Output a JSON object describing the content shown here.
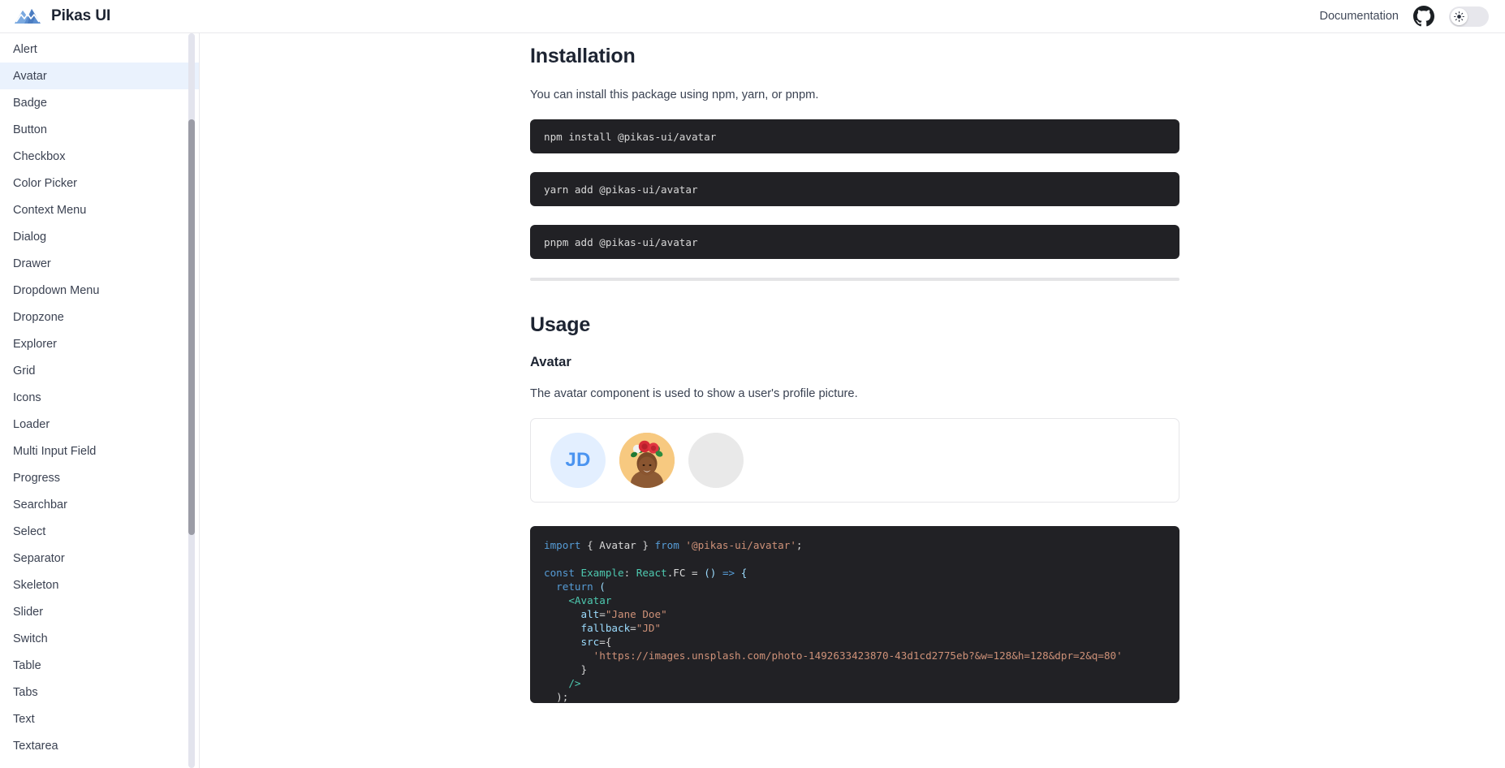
{
  "header": {
    "brand_title": "Pikas UI",
    "logo_icon": "pikas-mountain-logo",
    "documentation_label": "Documentation",
    "github_icon": "github-icon",
    "theme_toggle_icon": "sun-icon",
    "theme_toggle_state": "light"
  },
  "sidebar": {
    "items": [
      {
        "label": "Alert",
        "active": false
      },
      {
        "label": "Avatar",
        "active": true
      },
      {
        "label": "Badge",
        "active": false
      },
      {
        "label": "Button",
        "active": false
      },
      {
        "label": "Checkbox",
        "active": false
      },
      {
        "label": "Color Picker",
        "active": false
      },
      {
        "label": "Context Menu",
        "active": false
      },
      {
        "label": "Dialog",
        "active": false
      },
      {
        "label": "Drawer",
        "active": false
      },
      {
        "label": "Dropdown Menu",
        "active": false
      },
      {
        "label": "Dropzone",
        "active": false
      },
      {
        "label": "Explorer",
        "active": false
      },
      {
        "label": "Grid",
        "active": false
      },
      {
        "label": "Icons",
        "active": false
      },
      {
        "label": "Loader",
        "active": false
      },
      {
        "label": "Multi Input Field",
        "active": false
      },
      {
        "label": "Progress",
        "active": false
      },
      {
        "label": "Searchbar",
        "active": false
      },
      {
        "label": "Select",
        "active": false
      },
      {
        "label": "Separator",
        "active": false
      },
      {
        "label": "Skeleton",
        "active": false
      },
      {
        "label": "Slider",
        "active": false
      },
      {
        "label": "Switch",
        "active": false
      },
      {
        "label": "Table",
        "active": false
      },
      {
        "label": "Tabs",
        "active": false
      },
      {
        "label": "Text",
        "active": false
      },
      {
        "label": "Textarea",
        "active": false
      }
    ]
  },
  "main": {
    "installation": {
      "title": "Installation",
      "description": "You can install this package using npm, yarn, or pnpm.",
      "commands": [
        "npm install @pikas-ui/avatar",
        "yarn add @pikas-ui/avatar",
        "pnpm add @pikas-ui/avatar"
      ]
    },
    "usage": {
      "title": "Usage",
      "subtitle": "Avatar",
      "description": "The avatar component is used to show a user's profile picture.",
      "demo_avatars": [
        {
          "type": "initials",
          "text": "JD",
          "bg": "#e3efff",
          "fg": "#4b94f0"
        },
        {
          "type": "photo",
          "text": "",
          "bg": "#f6c67a",
          "fg": ""
        },
        {
          "type": "empty",
          "text": "",
          "bg": "#e9e9e9",
          "fg": ""
        }
      ],
      "code": {
        "line1_kw_import": "import",
        "line1_brace_open": " { ",
        "line1_name": "Avatar",
        "line1_brace_close": " } ",
        "line1_kw_from": "from",
        "line1_module": " '@pikas-ui/avatar'",
        "line1_semi": ";",
        "line3_kw_const": "const",
        "line3_name": " Example",
        "line3_colon": ": ",
        "line3_type": "React",
        "line3_dot_fc": ".FC",
        "line3_eq": " = ",
        "line3_parens": "()",
        "line3_arrow": " => ",
        "line3_brace": "{",
        "line4_return": "  return",
        "line4_paren": " (",
        "line5_tag": "    <Avatar",
        "line6_attr": "      alt",
        "line6_eq": "=",
        "line6_val": "\"Jane Doe\"",
        "line7_attr": "      fallback",
        "line7_eq": "=",
        "line7_val": "\"JD\"",
        "line8_attr": "      src",
        "line8_eq": "={",
        "line9_url": "        'https://images.unsplash.com/photo-1492633423870-43d1cd2775eb?&w=128&h=128&dpr=2&q=80'",
        "line10_close": "      }",
        "line11_selfclose": "    />",
        "line12_end": "  );"
      }
    }
  },
  "colors": {
    "accent": "#4b94f0",
    "sidebar_active_bg": "#eaf2fd",
    "code_bg": "#212125",
    "border": "#e6e6e9"
  }
}
